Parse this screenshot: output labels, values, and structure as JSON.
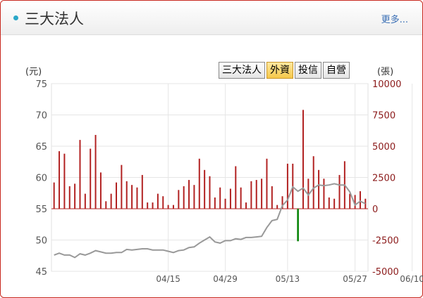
{
  "header": {
    "title": "三大法人",
    "more_label": "更多..."
  },
  "tabs": [
    {
      "label": "三大法人",
      "active": false
    },
    {
      "label": "外資",
      "active": true
    },
    {
      "label": "投信",
      "active": false
    },
    {
      "label": "自營",
      "active": false
    }
  ],
  "chart_data": {
    "type": "bar+line",
    "left_axis_label": "(元)",
    "right_axis_label": "(張)",
    "left_ylim": [
      45,
      75
    ],
    "left_ticks": [
      45,
      50,
      55,
      60,
      65,
      70,
      75
    ],
    "right_ylim": [
      -5000,
      10000
    ],
    "right_ticks": [
      -5000,
      -2500,
      0,
      2500,
      5000,
      7500,
      10000
    ],
    "x_tick_labels": [
      "04/15",
      "04/29",
      "05/13",
      "05/27",
      "06/10"
    ],
    "x_tick_index": [
      22,
      33,
      45,
      58,
      69
    ],
    "grid": true,
    "colors": {
      "bar_positive": "#b22222",
      "bar_negative": "#008000",
      "price_line": "#999999"
    },
    "series": [
      {
        "type": "bar",
        "axis": "right",
        "values": [
          2100,
          4600,
          4400,
          1800,
          2000,
          5500,
          1200,
          4800,
          5900,
          2900,
          600,
          1200,
          2100,
          3500,
          2200,
          1900,
          1700,
          2700,
          500,
          500,
          1200,
          1000,
          300,
          300,
          1500,
          1800,
          2300,
          1900,
          4000,
          3100,
          2600,
          900,
          1700,
          800,
          1600,
          3400,
          1700,
          500,
          2200,
          2300,
          2400,
          4000,
          1800,
          300,
          1000,
          3600,
          3600,
          -2600,
          7900,
          2400,
          4200,
          3100,
          2400,
          900,
          800,
          2700,
          3800,
          1200,
          1100,
          1400,
          800
        ]
      },
      {
        "type": "line",
        "axis": "left",
        "values": [
          47.6,
          47.9,
          47.6,
          47.6,
          47.2,
          47.8,
          47.6,
          47.9,
          48.3,
          48.1,
          47.9,
          47.9,
          48.0,
          48.0,
          48.5,
          48.4,
          48.5,
          48.6,
          48.6,
          48.4,
          48.4,
          48.4,
          48.2,
          48.0,
          48.3,
          48.4,
          48.8,
          48.9,
          49.5,
          50.0,
          50.5,
          49.7,
          49.5,
          49.9,
          49.9,
          50.2,
          50.1,
          50.4,
          50.4,
          50.5,
          50.6,
          52.0,
          53.1,
          53.3,
          55.5,
          56.4,
          58.5,
          57.8,
          58.3,
          57.2,
          58.3,
          58.8,
          58.7,
          58.8,
          59.0,
          58.8,
          58.8,
          57.7,
          55.6,
          56.2,
          55.8
        ]
      }
    ]
  }
}
